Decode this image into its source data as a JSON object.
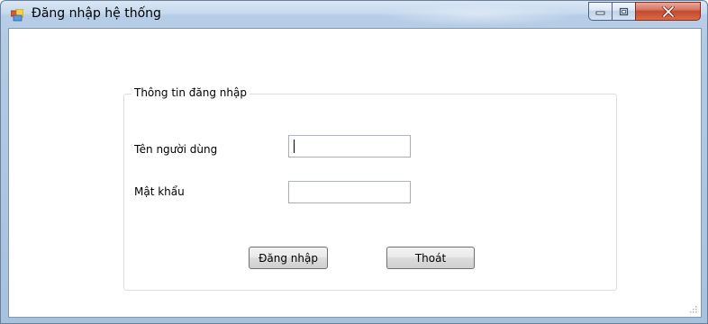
{
  "window": {
    "title": "Đăng nhập hệ thống",
    "icon": "windows-form-icon"
  },
  "caption_buttons": {
    "minimize_icon": "minimize-icon",
    "maximize_icon": "maximize-icon",
    "close_icon": "close-icon"
  },
  "login_group": {
    "legend": "Thông tin đăng nhập",
    "username_label": "Tên người dùng",
    "username_value": "",
    "password_label": "Mật khẩu",
    "password_value": "",
    "login_button": "Đăng nhập",
    "exit_button": "Thoát"
  },
  "colors": {
    "titlebar": "#c6d9ee",
    "close_button": "#c44a2e",
    "groupbox_border": "#d5dfe5",
    "client_background": "#ffffff"
  }
}
